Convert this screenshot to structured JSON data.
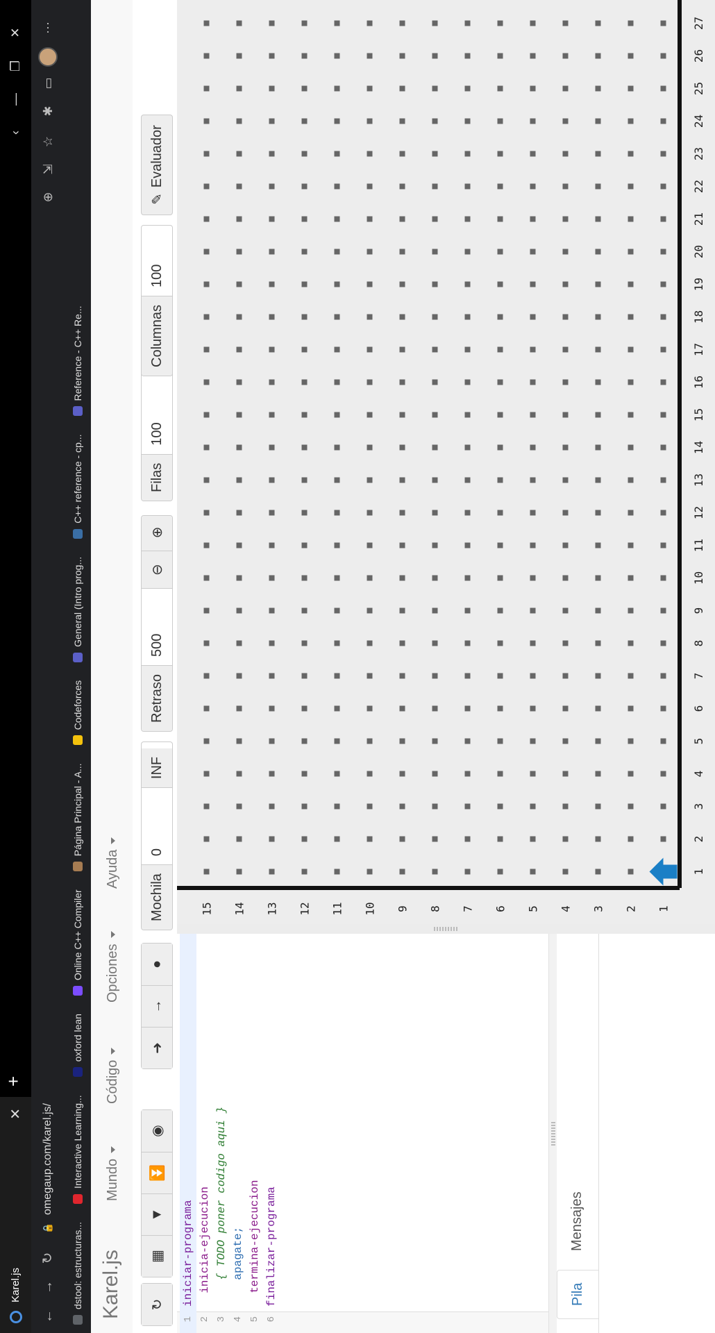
{
  "browser": {
    "tab_title": "Karel.js",
    "url": "omegaup.com/karel.js/",
    "bookmarks": [
      {
        "label": "dstool: estructuras...",
        "icon": "globe-icon",
        "color": "#5f6368"
      },
      {
        "label": "Interactive Learning...",
        "icon": "opera-icon",
        "color": "#e0262e"
      },
      {
        "label": "oxford lean",
        "icon": "oup-icon",
        "color": "#1a237e"
      },
      {
        "label": "Online C++ Compiler",
        "icon": "arrow-icon",
        "color": "#7c4dff"
      },
      {
        "label": "Página Principal - A...",
        "icon": "mushroom-icon",
        "color": "#a67c52"
      },
      {
        "label": "Codeforces",
        "icon": "bars-icon",
        "color": "#f4c20d"
      },
      {
        "label": "General (Intro prog...",
        "icon": "teams-icon",
        "color": "#5b5fc7"
      },
      {
        "label": "C++ reference - cp...",
        "icon": "cpp-icon",
        "color": "#3a6ea5"
      },
      {
        "label": "Reference - C++ Re...",
        "icon": "cplusplus-icon",
        "color": "#5b5fc7"
      }
    ]
  },
  "app": {
    "brand": "Karel.js",
    "menus": [
      "Mundo",
      "Código",
      "Opciones",
      "Ayuda"
    ],
    "mochila_label": "Mochila",
    "mochila_value": "0",
    "inf_label": "INF",
    "retraso_label": "Retraso",
    "retraso_value": "500",
    "filas_label": "Filas",
    "filas_value": "100",
    "columnas_label": "Columnas",
    "columnas_value": "100",
    "evaluador_label": "Evaluador"
  },
  "editor": {
    "lines": [
      {
        "num": "1",
        "text": "iniciar-programa"
      },
      {
        "num": "2",
        "text": "  inicia-ejecucion"
      },
      {
        "num": "3",
        "text": "    { TODO poner codigo aqui }"
      },
      {
        "num": "4",
        "text": "    apagate;"
      },
      {
        "num": "5",
        "text": "  termina-ejecucion"
      },
      {
        "num": "6",
        "text": "finalizar-programa"
      }
    ]
  },
  "panel_tabs": [
    "Pila",
    "Mensajes"
  ],
  "world": {
    "row_labels": [
      "1",
      "2",
      "3",
      "4",
      "5",
      "6",
      "7",
      "8",
      "9",
      "10",
      "11",
      "12",
      "13",
      "14",
      "15"
    ],
    "col_labels": [
      "1",
      "2",
      "3",
      "4",
      "5",
      "6",
      "7",
      "8",
      "9",
      "10",
      "11",
      "12",
      "13",
      "14",
      "15",
      "16",
      "17",
      "18",
      "19",
      "20",
      "21",
      "22",
      "23",
      "24",
      "25",
      "26",
      "27"
    ],
    "karel_row": 1,
    "karel_col": 1,
    "karel_facing": "north",
    "karel_color": "#1a7fc6"
  }
}
